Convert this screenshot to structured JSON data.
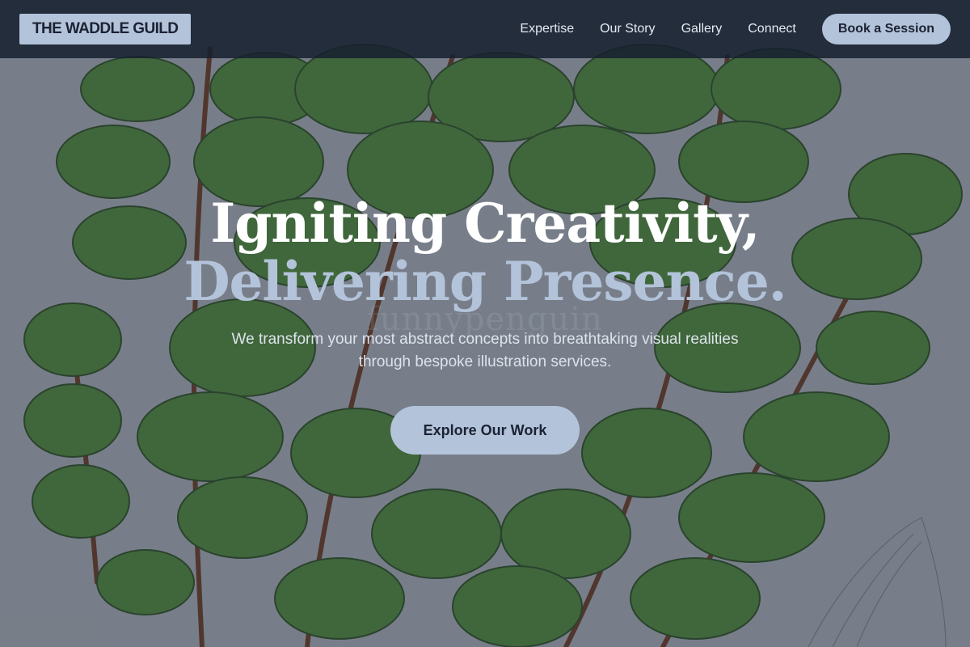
{
  "brand": {
    "logo_text": "THE WADDLE GUILD"
  },
  "nav": {
    "links": [
      "Expertise",
      "Our Story",
      "Gallery",
      "Connect"
    ],
    "cta_label": "Book a Session"
  },
  "hero": {
    "headline_line1": "Igniting Creativity,",
    "headline_line2": "Delivering Presence.",
    "watermark": "funnypenguin",
    "subtitle": "We transform your most abstract concepts into breathtaking visual realities through bespoke illustration services.",
    "cta_label": "Explore Our Work"
  },
  "colors": {
    "accent": "#b3c3da",
    "navbar": "#162030",
    "text_dark": "#1b2233",
    "leaf_green": "#4f8a3a"
  },
  "icons": [
    "fern-illustration"
  ]
}
